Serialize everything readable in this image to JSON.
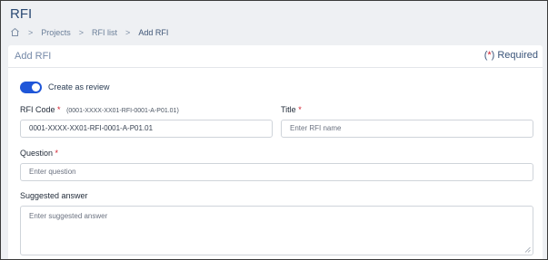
{
  "page": {
    "title": "RFI"
  },
  "breadcrumb": {
    "items": [
      "Projects",
      "RFI list",
      "Add RFI"
    ],
    "separator": ">"
  },
  "card": {
    "title": "Add RFI",
    "required_prefix": "(",
    "required_star": "*",
    "required_suffix": ") Required"
  },
  "toggle": {
    "label": "Create as review",
    "checked": true
  },
  "form": {
    "rfi_code": {
      "label": "RFI Code",
      "hint": "(0001-XXXX-XX01-RFI-0001-A-P01.01)",
      "value": "0001-XXXX-XX01-RFI-0001-A-P01.01"
    },
    "title": {
      "label": "Title",
      "placeholder": "Enter RFI name"
    },
    "question": {
      "label": "Question",
      "placeholder": "Enter question"
    },
    "suggested_answer": {
      "label": "Suggested answer",
      "placeholder": "Enter suggested answer"
    }
  },
  "colors": {
    "accent": "#1f56d8",
    "required": "#d11a2a",
    "title": "#2b4a74"
  }
}
